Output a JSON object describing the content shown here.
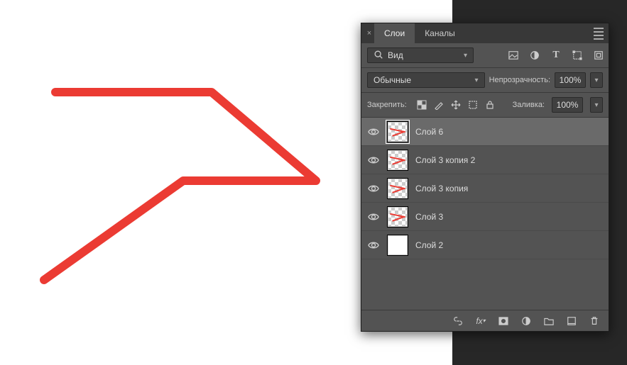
{
  "canvas": {
    "stroke": "#eb3b33"
  },
  "panel": {
    "tabs": {
      "layers": "Слои",
      "channels": "Каналы"
    },
    "filter": {
      "search_label": "Вид"
    },
    "icons": {
      "image": "image-icon",
      "adjust": "contrast-icon",
      "text": "type-icon",
      "shape": "transform-icon",
      "smart": "smartobject-icon",
      "dot": "color-dot"
    },
    "blend": {
      "mode": "Обычные",
      "opacity_label": "Непрозрачность:",
      "opacity_value": "100%"
    },
    "lock": {
      "label": "Закрепить:",
      "fill_label": "Заливка:",
      "fill_value": "100%"
    },
    "layers": [
      {
        "name": "Слой 6",
        "thumb": "trans-red",
        "selected": true
      },
      {
        "name": "Слой 3 копия 2",
        "thumb": "trans-red",
        "selected": false
      },
      {
        "name": "Слой 3 копия",
        "thumb": "trans-red",
        "selected": false
      },
      {
        "name": "Слой 3",
        "thumb": "trans-red",
        "selected": false
      },
      {
        "name": "Слой 2",
        "thumb": "white",
        "selected": false
      }
    ],
    "footer_icons": [
      "link",
      "fx",
      "mask",
      "adjust-circle",
      "group",
      "new",
      "trash"
    ]
  }
}
